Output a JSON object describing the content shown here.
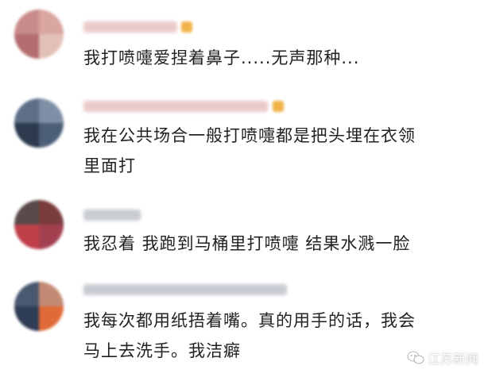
{
  "comments": [
    {
      "text_line1": "我打喷嚏爱捏着鼻子.....无声那种..."
    },
    {
      "text_line1": "我在公共场合一般打喷嚏都是把头埋在衣领",
      "text_line2": "里面打"
    },
    {
      "text_line1": "我忍着 我跑到马桶里打喷嚏 结果水溅一脸"
    },
    {
      "text_line1": "我每次都用纸捂着嘴。真的用手的话，我会",
      "text_line2": "马上去洗手。我洁癖"
    }
  ],
  "watermark": {
    "label": "江苏新闻",
    "icon": "wechat-icon"
  },
  "colors": {
    "text": "#222222",
    "username_blur": "#e9c9c9",
    "badge": "#f2b34a"
  }
}
